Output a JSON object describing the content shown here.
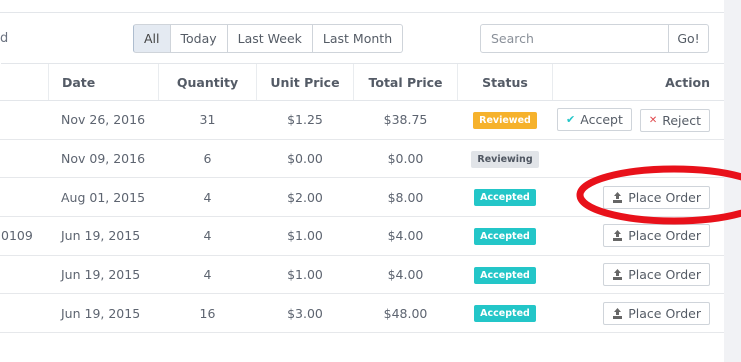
{
  "toolbar": {
    "left_fragment": "d",
    "filters": [
      "All",
      "Today",
      "Last Week",
      "Last Month"
    ],
    "active_filter": "All",
    "search_placeholder": "Search",
    "go_label": "Go!"
  },
  "table": {
    "headers": {
      "date": "Date",
      "quantity": "Quantity",
      "unit_price": "Unit Price",
      "total_price": "Total Price",
      "status": "Status",
      "action": "Action"
    },
    "rows": [
      {
        "id": "",
        "date": "Nov 26, 2016",
        "quantity": "31",
        "unit_price": "$1.25",
        "total_price": "$38.75",
        "status": "Reviewed"
      },
      {
        "id": "",
        "date": "Nov 09, 2016",
        "quantity": "6",
        "unit_price": "$0.00",
        "total_price": "$0.00",
        "status": "Reviewing"
      },
      {
        "id": "",
        "date": "Aug 01, 2015",
        "quantity": "4",
        "unit_price": "$2.00",
        "total_price": "$8.00",
        "status": "Accepted"
      },
      {
        "id": "0109",
        "date": "Jun 19, 2015",
        "quantity": "4",
        "unit_price": "$1.00",
        "total_price": "$4.00",
        "status": "Accepted"
      },
      {
        "id": "",
        "date": "Jun 19, 2015",
        "quantity": "4",
        "unit_price": "$1.00",
        "total_price": "$4.00",
        "status": "Accepted"
      },
      {
        "id": "",
        "date": "Jun 19, 2015",
        "quantity": "16",
        "unit_price": "$3.00",
        "total_price": "$48.00",
        "status": "Accepted"
      }
    ],
    "actions": {
      "accept": "Accept",
      "reject": "Reject",
      "place_order": "Place Order"
    }
  },
  "colors": {
    "reviewed": "#f6b22c",
    "reviewing": "#e1e4e8",
    "accepted": "#23c6c8",
    "annotation": "#e8111a"
  },
  "icons": {
    "accept": "check-icon",
    "reject": "x-icon",
    "place_order": "upload-icon"
  }
}
